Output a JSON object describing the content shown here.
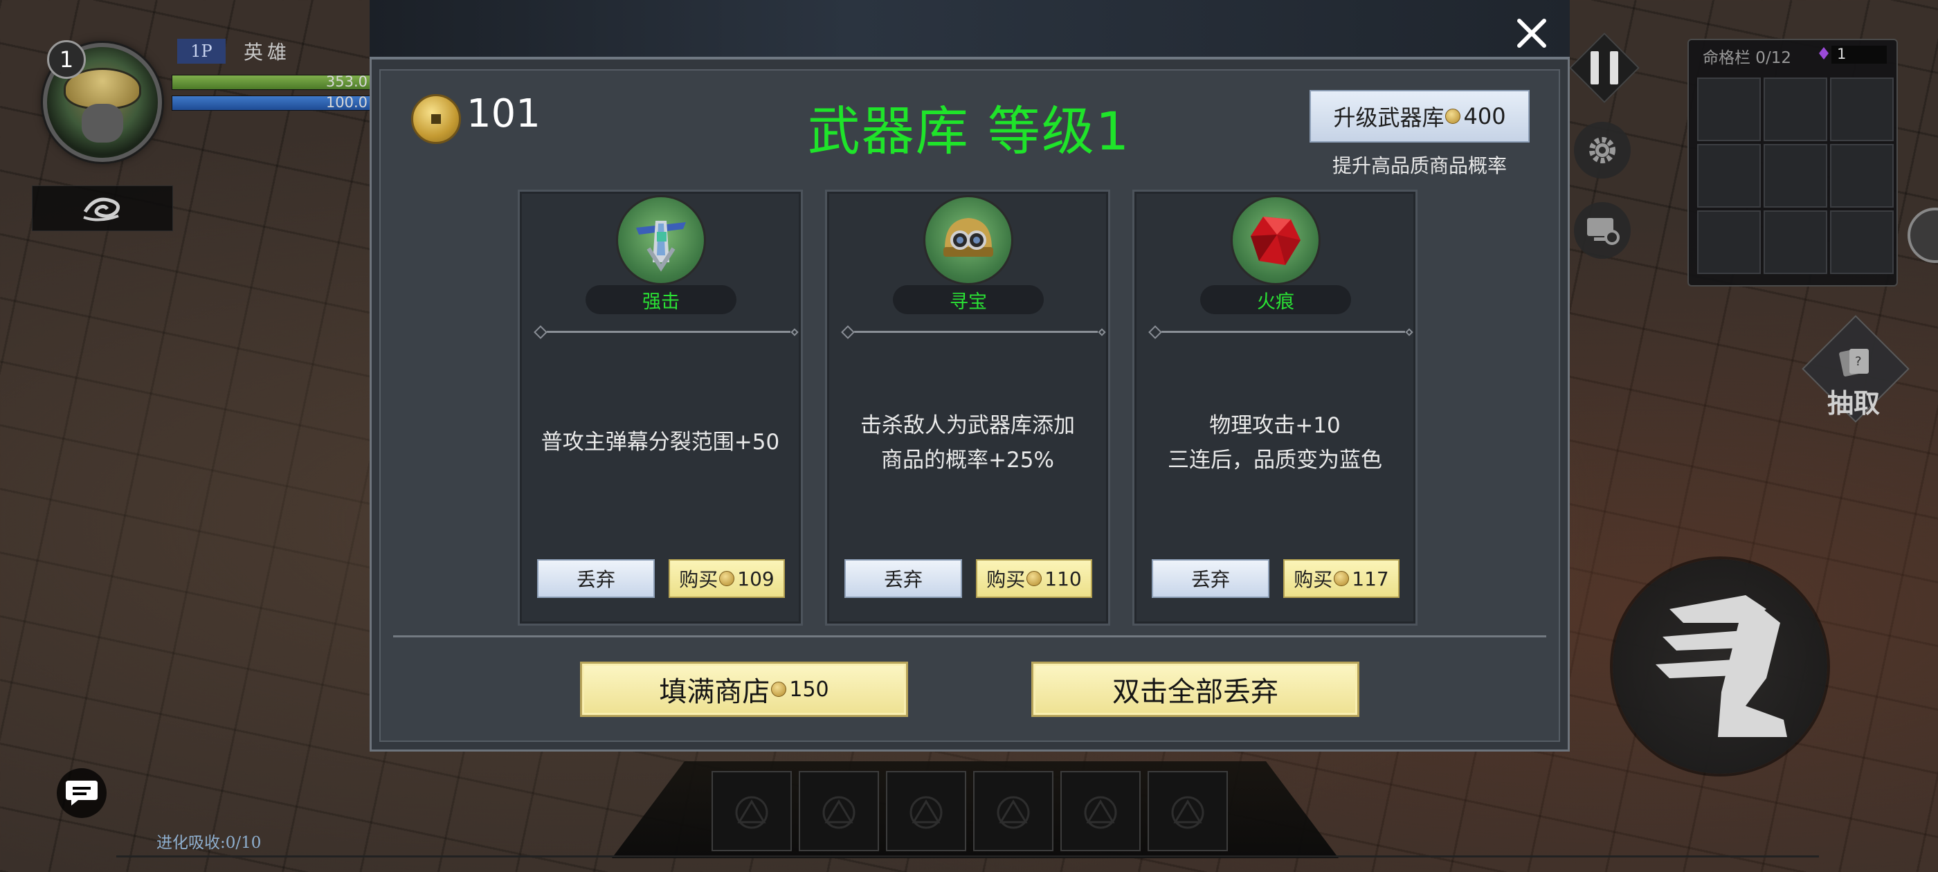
{
  "hud": {
    "player_level": "1",
    "player_tag": "1P",
    "hero_label": "英雄",
    "hp_value": "353.0",
    "mp_value": "100.0",
    "evolution_text": "进化吸收:0/10",
    "fate_title": "命格栏 0/12",
    "fate_count": "1",
    "draw_label": "抽取",
    "hp_fill": 1.0,
    "mp_fill": 1.0
  },
  "shop": {
    "gold": "101",
    "title": "武器库 等级1",
    "upgrade_label": "升级武器库",
    "upgrade_cost": "400",
    "upgrade_note": "提升高品质商品概率",
    "cards": [
      {
        "name": "强击",
        "icon": "crossbow-icon",
        "desc_line1": "普攻主弹幕分裂范围+50",
        "desc_line2": "",
        "discard": "丢弃",
        "buy": "购买",
        "price": "109"
      },
      {
        "name": "寻宝",
        "icon": "goggle-helmet-icon",
        "desc_line1": "击杀敌人为武器库添加",
        "desc_line2": "商品的概率+25%",
        "discard": "丢弃",
        "buy": "购买",
        "price": "110"
      },
      {
        "name": "火痕",
        "icon": "red-gem-icon",
        "desc_line1": "物理攻击+10",
        "desc_line2": "三连后，品质变为蓝色",
        "discard": "丢弃",
        "buy": "购买",
        "price": "117"
      }
    ],
    "fill_label": "填满商店",
    "fill_cost": "150",
    "discard_all_label": "双击全部丢弃"
  },
  "colors": {
    "title_green": "#1fe42a",
    "name_green": "#2ae234",
    "buy_yellow": "#ece08a",
    "discard_blue": "#c8d6ea"
  }
}
